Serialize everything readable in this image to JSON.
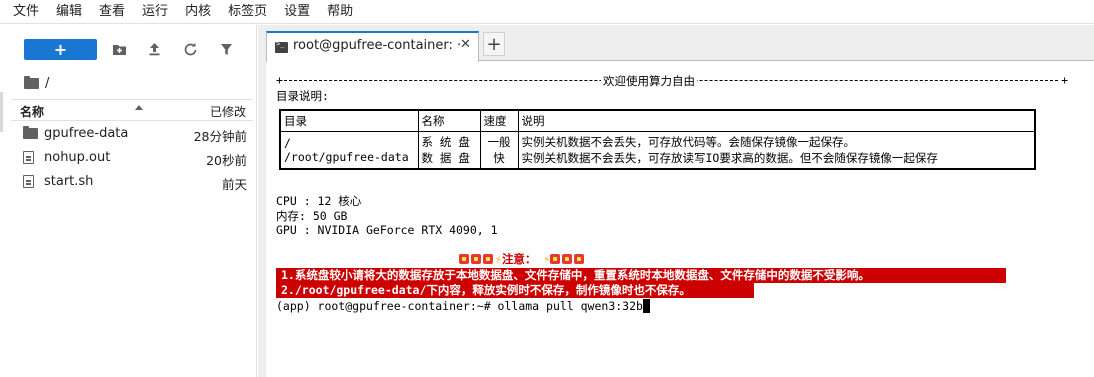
{
  "menu": [
    "文件",
    "编辑",
    "查看",
    "运行",
    "内核",
    "标签页",
    "设置",
    "帮助"
  ],
  "file_browser": {
    "new_button_label": "+",
    "path": "/",
    "columns": {
      "name": "名称",
      "modified": "已修改"
    },
    "files": [
      {
        "name": "gpufree-data",
        "type": "folder",
        "modified": "28分钟前"
      },
      {
        "name": "nohup.out",
        "type": "file",
        "modified": "20秒前"
      },
      {
        "name": "start.sh",
        "type": "file",
        "modified": "前天"
      }
    ],
    "toolbar_icons": [
      "new-folder-icon",
      "upload-icon",
      "refresh-icon",
      "filter-icon"
    ]
  },
  "tabs": {
    "active_title": "root@gpufree-container: ·",
    "close_label": "✕",
    "add_label": "+"
  },
  "terminal": {
    "banner_text": "欢迎使用算力自由",
    "dir_intro": "目录说明:",
    "table": {
      "headers": [
        "目录",
        "名称",
        "速度",
        "说明"
      ],
      "row_dirs": [
        "/",
        "/root/gpufree-data"
      ],
      "row_names": [
        "系 统 盘",
        "数 据 盘"
      ],
      "row_speed": [
        "一般",
        "快"
      ],
      "row_desc": [
        "实例关机数据不会丢失，可存放代码等。会随保存镜像一起保存。",
        "实例关机数据不会丢失，可存放读写IO要求高的数据。但不会随保存镜像一起保存"
      ]
    },
    "cpu": "CPU : 12 核心",
    "memory": "内存: 50 GB",
    "gpu": "GPU : NVIDIA GeForce RTX 4090, 1",
    "notice_title": "注意：",
    "notice_lines": [
      "1.系统盘较小请将大的数据存放于本地数据盘、文件存储中，重置系统时本地数据盘、文件存储中的数据不受影响。",
      "2./root/gpufree-data/下内容，释放实例时不保存，制作镜像时也不保存。"
    ],
    "prompt": "(app) root@gpufree-container:~# ollama pull qwen3:32b"
  },
  "colors": {
    "accent": "#1976d2",
    "notice_bg": "#cc0000"
  }
}
